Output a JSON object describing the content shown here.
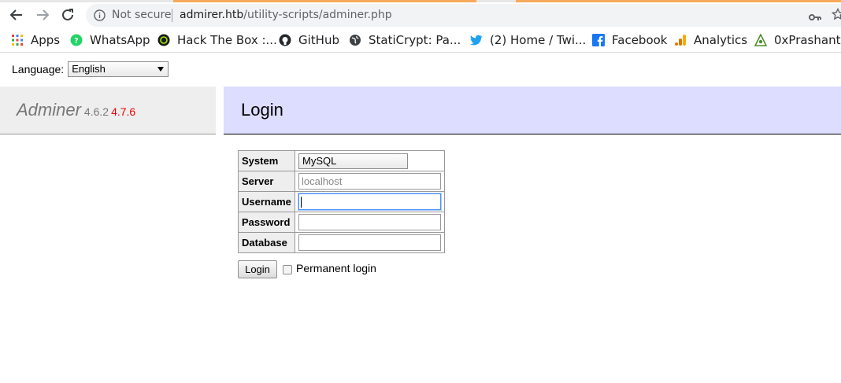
{
  "browser": {
    "security_label": "Not secure",
    "url_host": "admirer.htb",
    "url_path": "/utility-scripts/adminer.php",
    "bookmarks": [
      {
        "label": "Apps",
        "icon": "apps-grid-icon"
      },
      {
        "label": "WhatsApp",
        "icon": "whatsapp-icon"
      },
      {
        "label": "Hack The Box :...",
        "icon": "hackthebox-icon"
      },
      {
        "label": "GitHub",
        "icon": "github-icon"
      },
      {
        "label": "StatiCrypt: Pa...",
        "icon": "globe-icon"
      },
      {
        "label": "(2) Home / Twi...",
        "icon": "twitter-icon"
      },
      {
        "label": "Facebook",
        "icon": "facebook-icon"
      },
      {
        "label": "Analytics",
        "icon": "analytics-icon"
      },
      {
        "label": "0xPrashant",
        "icon": "prashant-icon"
      }
    ]
  },
  "language": {
    "label": "Language:",
    "selected": "English"
  },
  "brand": {
    "name": "Adminer",
    "version": "4.6.2",
    "new_version": "4.7.6"
  },
  "page": {
    "title": "Login"
  },
  "form": {
    "system_label": "System",
    "system_value": "MySQL",
    "server_label": "Server",
    "server_placeholder": "localhost",
    "username_label": "Username",
    "password_label": "Password",
    "database_label": "Database",
    "submit_label": "Login",
    "permanent_label": "Permanent login"
  },
  "colors": {
    "header_bg": "#ddddff",
    "menu_bg": "#eeeeee",
    "new_version": "#ee0000"
  }
}
